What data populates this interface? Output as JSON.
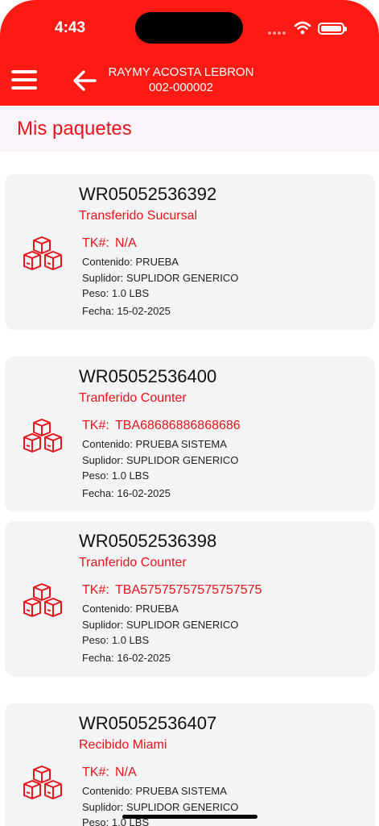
{
  "status_bar": {
    "time": "4:43"
  },
  "header": {
    "name": "RAYMY ACOSTA LEBRON",
    "code": "002-000002"
  },
  "page": {
    "title": "Mis paquetes"
  },
  "labels": {
    "tk": "TK#:",
    "contenido": "Contenido:",
    "suplidor": "Suplidor:",
    "peso": "Peso:",
    "fecha": "Fecha:"
  },
  "packages": [
    {
      "wr": "WR05052536392",
      "status": "Transferido Sucursal",
      "tk": "N/A",
      "contenido": "PRUEBA",
      "suplidor": "SUPLIDOR GENERICO",
      "peso": "1.0 LBS",
      "fecha": "15-02-2025"
    },
    {
      "wr": "WR05052536400",
      "status": "Tranferido Counter",
      "tk": "TBA68686886868686",
      "contenido": "PRUEBA SISTEMA",
      "suplidor": "SUPLIDOR GENERICO",
      "peso": "1.0 LBS",
      "fecha": "16-02-2025"
    },
    {
      "wr": "WR05052536398",
      "status": "Tranferido Counter",
      "tk": "TBA57575757575757575",
      "contenido": "PRUEBA",
      "suplidor": "SUPLIDOR GENERICO",
      "peso": "1.0 LBS",
      "fecha": "16-02-2025"
    },
    {
      "wr": "WR05052536407",
      "status": "Recibido  Miami",
      "tk": "N/A",
      "contenido": "PRUEBA SISTEMA",
      "suplidor": "SUPLIDOR GENERICO",
      "peso": "1.0 LBS",
      "fecha": ""
    }
  ],
  "icons": {
    "menu": "hamburger-menu-icon",
    "back": "arrow-left-icon",
    "package": "boxes-icon",
    "wifi": "wifi-icon",
    "battery": "battery-icon"
  },
  "colors": {
    "brand_red": "#ff1a13",
    "accent_text": "#e8141b",
    "card_bg": "#f4f4f4",
    "title_bar_bg": "#fcf4fb"
  }
}
